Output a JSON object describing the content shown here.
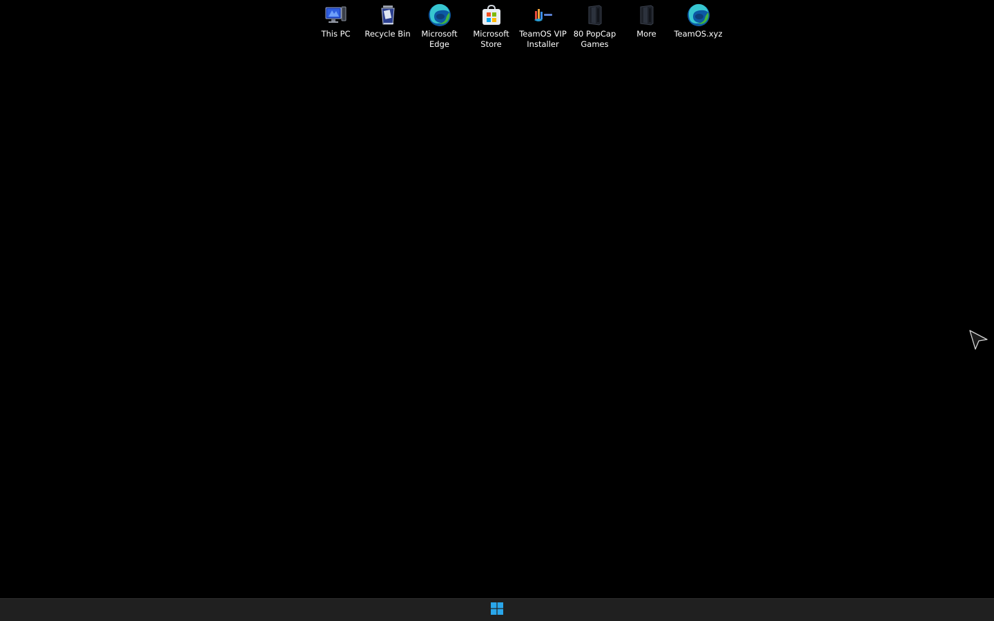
{
  "desktop": {
    "background_color": "#000000",
    "icons": [
      {
        "label": "This PC",
        "icon": "this-pc-icon"
      },
      {
        "label": "Recycle Bin",
        "icon": "recycle-bin-icon"
      },
      {
        "label": "Microsoft\nEdge",
        "icon": "edge-icon"
      },
      {
        "label": "Microsoft\nStore",
        "icon": "store-icon"
      },
      {
        "label": "TeamOS VIP\nInstaller",
        "icon": "installer-icon"
      },
      {
        "label": "80 PopCap\nGames",
        "icon": "folder-dark-icon"
      },
      {
        "label": "More",
        "icon": "folder-dark-icon"
      },
      {
        "label": "TeamOS.xyz",
        "icon": "edge-icon"
      }
    ]
  },
  "taskbar": {
    "background_color": "#202020",
    "start_icon": "windows-logo-icon",
    "accent_color": "#2aa6ea"
  },
  "cursor": {
    "icon": "mouse-pointer-icon"
  }
}
